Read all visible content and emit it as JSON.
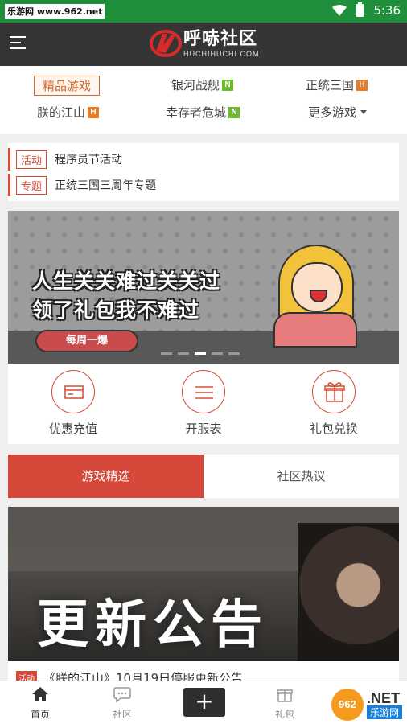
{
  "status_bar": {
    "carrier": "乐游网 www.962.net",
    "time": "5:36"
  },
  "header": {
    "logo_text": "呼哧社区",
    "logo_sub": "HUCHIHUCHI.COM"
  },
  "game_nav": {
    "items": [
      {
        "label": "精品游戏",
        "badge": "",
        "active": true
      },
      {
        "label": "银河战舰",
        "badge": "N"
      },
      {
        "label": "正统三国",
        "badge": "H"
      },
      {
        "label": "朕的江山",
        "badge": "H"
      },
      {
        "label": "幸存者危城",
        "badge": "N"
      },
      {
        "label": "更多游戏",
        "badge": ""
      }
    ]
  },
  "notices": [
    {
      "tag": "活动",
      "text": "程序员节活动"
    },
    {
      "tag": "专题",
      "text": "正统三国三周年专题"
    }
  ],
  "banner": {
    "line1": "人生关关难过关关过",
    "line2": "领了礼包我不难过",
    "button": "每周一爆",
    "active_slide": 3,
    "slide_count": 5
  },
  "quick_actions": [
    {
      "label": "优惠充值",
      "icon": "card-icon"
    },
    {
      "label": "开服表",
      "icon": "list-icon"
    },
    {
      "label": "礼包兑换",
      "icon": "gift-icon"
    }
  ],
  "tabs": [
    {
      "label": "游戏精选",
      "active": true
    },
    {
      "label": "社区热议",
      "active": false
    }
  ],
  "news": {
    "image_title": "更新公告",
    "tag": "活动",
    "caption": "《朕的江山》10月19日停服更新公告"
  },
  "bottom_nav": [
    {
      "label": "首页",
      "icon": "home-icon",
      "active": true
    },
    {
      "label": "社区",
      "icon": "chat-icon",
      "active": false
    },
    {
      "label": "+",
      "icon": "plus-icon"
    },
    {
      "label": "礼包",
      "icon": "gift-icon",
      "active": false
    }
  ],
  "watermark": {
    "brand": "962",
    "domain": ".NET",
    "site": "乐游网"
  },
  "colors": {
    "status": "#1f8f3b",
    "header": "#353535",
    "accent": "#d6493a",
    "badge_new": "#6cba2d",
    "badge_hot": "#e97a25"
  }
}
